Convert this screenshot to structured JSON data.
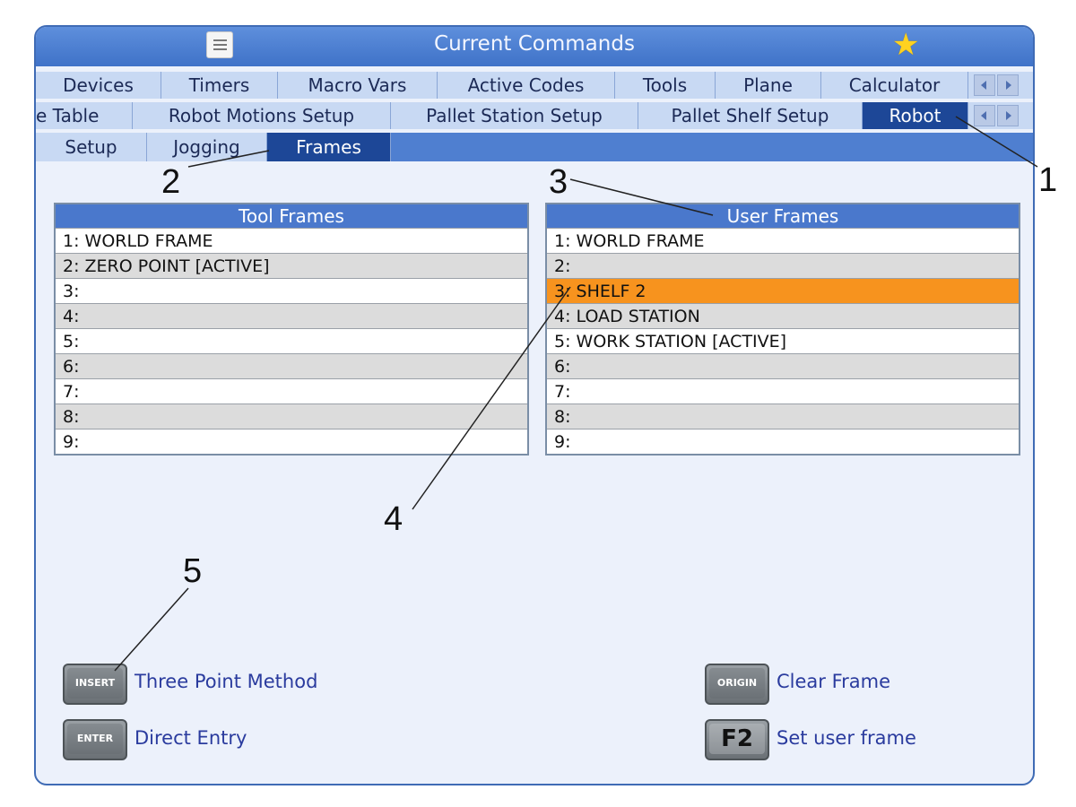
{
  "window": {
    "title": "Current Commands"
  },
  "tabs_row1": [
    "Devices",
    "Timers",
    "Macro Vars",
    "Active Codes",
    "Tools",
    "Plane",
    "Calculator"
  ],
  "tabs_row2": [
    "e Table",
    "Robot Motions Setup",
    "Pallet Station Setup",
    "Pallet Shelf Setup",
    "Robot"
  ],
  "tabs_row3": [
    "Setup",
    "Jogging",
    "Frames"
  ],
  "tool_frames": {
    "header": "Tool Frames",
    "rows": [
      "1: WORLD FRAME",
      "2: ZERO POINT [ACTIVE]",
      "3:",
      "4:",
      "5:",
      "6:",
      "7:",
      "8:",
      "9:"
    ]
  },
  "user_frames": {
    "header": "User Frames",
    "rows": [
      "1: WORLD FRAME",
      "2:",
      "3: SHELF 2",
      "4: LOAD STATION",
      "5: WORK STATION [ACTIVE]",
      "6:",
      "7:",
      "8:",
      "9:"
    ]
  },
  "actions": {
    "insert": {
      "key": "INSERT",
      "label": "Three Point Method"
    },
    "enter": {
      "key": "ENTER",
      "label": "Direct Entry"
    },
    "origin": {
      "key": "ORIGIN",
      "label": "Clear Frame"
    },
    "f2": {
      "key": "F2",
      "label": "Set user frame"
    }
  },
  "callouts": [
    "1",
    "2",
    "3",
    "4",
    "5"
  ],
  "colors": {
    "accent": "#1d4797",
    "selected_row": "#f7931e",
    "header": "#4a78cc"
  },
  "icons": [
    "menu-icon",
    "star-icon",
    "scroll-left-icon",
    "scroll-right-icon"
  ]
}
